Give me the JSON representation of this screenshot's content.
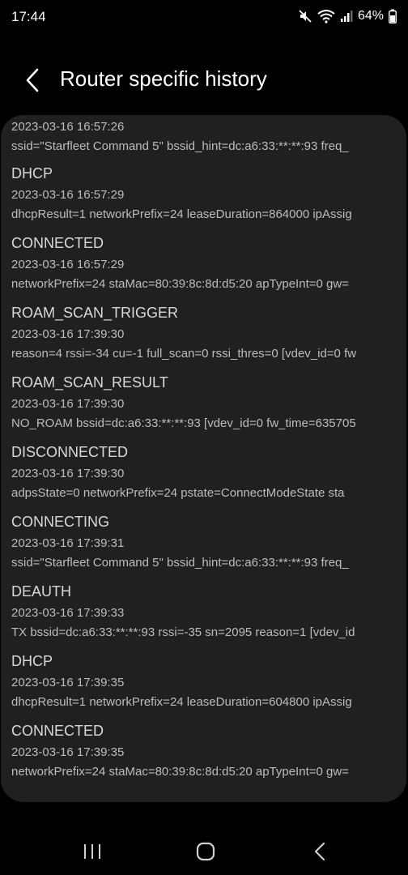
{
  "status_bar": {
    "time": "17:44",
    "battery": "64%",
    "icons": [
      "mute-icon",
      "wifi-icon",
      "signal-icon",
      "battery-icon"
    ]
  },
  "header": {
    "title": "Router specific history",
    "back_icon": "back-arrow-icon"
  },
  "history": [
    {
      "event": "",
      "date": "2023-03-16 16:57:26",
      "detail": "ssid=\"Starfleet Command 5\" bssid_hint=dc:a6:33:**:**:93 freq_"
    },
    {
      "event": "DHCP",
      "date": "2023-03-16 16:57:29",
      "detail": "dhcpResult=1 networkPrefix=24 leaseDuration=864000 ipAssig"
    },
    {
      "event": "CONNECTED",
      "date": "2023-03-16 16:57:29",
      "detail": "networkPrefix=24 staMac=80:39:8c:8d:d5:20 apTypeInt=0 gw="
    },
    {
      "event": "ROAM_SCAN_TRIGGER",
      "date": "2023-03-16 17:39:30",
      "detail": "reason=4 rssi=-34 cu=-1 full_scan=0 rssi_thres=0 [vdev_id=0 fw"
    },
    {
      "event": "ROAM_SCAN_RESULT",
      "date": "2023-03-16 17:39:30",
      "detail": "NO_ROAM bssid=dc:a6:33:**:**:93 [vdev_id=0 fw_time=635705"
    },
    {
      "event": "DISCONNECTED",
      "date": "2023-03-16 17:39:30",
      "detail": "adpsState=0 networkPrefix=24 pstate=ConnectModeState sta"
    },
    {
      "event": "CONNECTING",
      "date": "2023-03-16 17:39:31",
      "detail": "ssid=\"Starfleet Command 5\" bssid_hint=dc:a6:33:**:**:93 freq_"
    },
    {
      "event": "DEAUTH",
      "date": "2023-03-16 17:39:33",
      "detail": "TX bssid=dc:a6:33:**:**:93 rssi=-35 sn=2095 reason=1 [vdev_id"
    },
    {
      "event": "DHCP",
      "date": "2023-03-16 17:39:35",
      "detail": "dhcpResult=1 networkPrefix=24 leaseDuration=604800 ipAssig"
    },
    {
      "event": "CONNECTED",
      "date": "2023-03-16 17:39:35",
      "detail": "networkPrefix=24 staMac=80:39:8c:8d:d5:20 apTypeInt=0 gw="
    }
  ],
  "navbar": {
    "recents_icon": "recents-icon",
    "home_icon": "home-icon",
    "back_icon": "back-icon"
  }
}
